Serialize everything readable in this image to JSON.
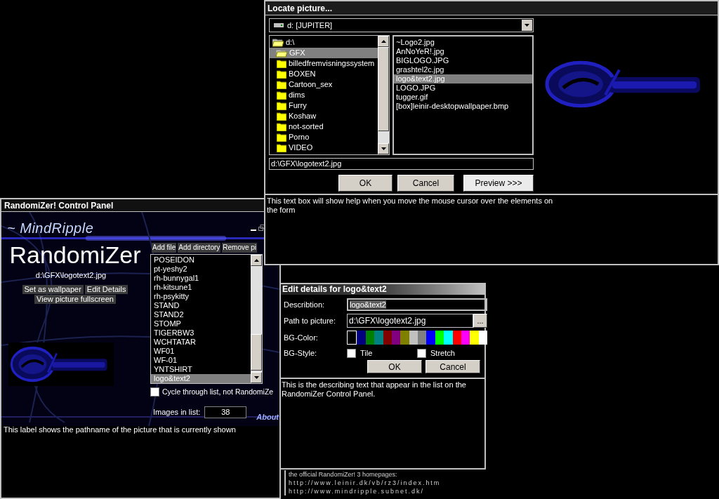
{
  "locate_window": {
    "title": "Locate picture...",
    "drive": {
      "label": "d: [JUPITER]"
    },
    "folders": [
      {
        "name": "d:\\",
        "open": true,
        "selected": false,
        "children": [
          {
            "name": "GFX",
            "open": true,
            "selected": true,
            "children": [
              {
                "name": "billedfremvisningssystem",
                "open": false,
                "selected": false
              },
              {
                "name": "BOXEN",
                "open": false,
                "selected": false
              },
              {
                "name": "Cartoon_sex",
                "open": false,
                "selected": false
              },
              {
                "name": "dims",
                "open": false,
                "selected": false
              },
              {
                "name": "Furry",
                "open": false,
                "selected": false
              },
              {
                "name": "Koshaw",
                "open": false,
                "selected": false
              },
              {
                "name": "not-sorted",
                "open": false,
                "selected": false
              },
              {
                "name": "Porno",
                "open": false,
                "selected": false
              },
              {
                "name": "VIDEO",
                "open": false,
                "selected": false
              }
            ]
          }
        ]
      }
    ],
    "files": [
      {
        "name": "~Logo2.jpg",
        "selected": false
      },
      {
        "name": "AnNoYeR!.jpg",
        "selected": false
      },
      {
        "name": "BIGLOGO.JPG",
        "selected": false
      },
      {
        "name": "grashtel2c.jpg",
        "selected": false
      },
      {
        "name": "logo&text2.jpg",
        "selected": true
      },
      {
        "name": "LOGO.JPG",
        "selected": false
      },
      {
        "name": "tugger.gif",
        "selected": false
      },
      {
        "name": "[box]leinir-desktopwallpaper.bmp",
        "selected": false
      }
    ],
    "path": {
      "value": "d:\\GFX\\logotext2.jpg"
    },
    "buttons": [
      {
        "label": "OK",
        "kind": "plain"
      },
      {
        "label": "Cancel",
        "kind": "plain"
      },
      {
        "label": "Preview >>>",
        "kind": "light"
      }
    ],
    "help_text": "This text box will show help when you move the mouse cursor over the elements on the form"
  },
  "control_panel": {
    "title": "RandomiZer! Control Panel",
    "brand": "~ MindRipple",
    "app_name": "RandomiZer",
    "current_path": "d:\\GFX\\logotext2.jpg",
    "actions": [
      {
        "label": "Set as wallpaper"
      },
      {
        "label": "Edit Details"
      },
      {
        "label": "View picture fullscreen"
      }
    ],
    "list_buttons": [
      {
        "label": "Add file"
      },
      {
        "label": "Add directory"
      },
      {
        "label": "Remove pi"
      }
    ],
    "items": [
      {
        "name": "POSEIDON",
        "selected": false
      },
      {
        "name": "pt-yeshy2",
        "selected": false
      },
      {
        "name": "rh-bunnygal1",
        "selected": false
      },
      {
        "name": "rh-kitsune1",
        "selected": false
      },
      {
        "name": "rh-psykitty",
        "selected": false
      },
      {
        "name": "STAND",
        "selected": false
      },
      {
        "name": "STAND2",
        "selected": false
      },
      {
        "name": "STOMP",
        "selected": false
      },
      {
        "name": "TIGERBW3",
        "selected": false
      },
      {
        "name": "WCHTATAR",
        "selected": false
      },
      {
        "name": "WF01",
        "selected": false
      },
      {
        "name": "WF-01",
        "selected": false
      },
      {
        "name": "YNTSHIRT",
        "selected": false
      },
      {
        "name": "logo&text2",
        "selected": true
      }
    ],
    "cycle": {
      "label": "Cycle through list, not RandomiZe",
      "checked": false
    },
    "count": {
      "label": "Images in list:",
      "value": "38"
    },
    "about": "About",
    "status": "This label shows the pathname of the picture that is currently shown"
  },
  "edit_window": {
    "title": "Edit details for logo&text2",
    "description": {
      "label": "Describtion:",
      "value": "logo&text2"
    },
    "path": {
      "label": "Path to picture:",
      "value": "d:\\GFX\\logotext2.jpg",
      "browse": "..."
    },
    "bg_color": {
      "label": "BG-Color:",
      "swatches": [
        {
          "color": "#000000",
          "selected": true
        },
        {
          "color": "#000080",
          "selected": false
        },
        {
          "color": "#008000",
          "selected": false
        },
        {
          "color": "#008080",
          "selected": false
        },
        {
          "color": "#800000",
          "selected": false
        },
        {
          "color": "#800080",
          "selected": false
        },
        {
          "color": "#808000",
          "selected": false
        },
        {
          "color": "#c0c0c0",
          "selected": false
        },
        {
          "color": "#808080",
          "selected": false
        },
        {
          "color": "#0000ff",
          "selected": false
        },
        {
          "color": "#00ff00",
          "selected": false
        },
        {
          "color": "#00ffff",
          "selected": false
        },
        {
          "color": "#ff0000",
          "selected": false
        },
        {
          "color": "#ff00ff",
          "selected": false
        },
        {
          "color": "#ffff00",
          "selected": false
        },
        {
          "color": "#ffffff",
          "selected": false
        }
      ]
    },
    "bg_style": {
      "label": "BG-Style:",
      "options": [
        {
          "label": "Tile",
          "checked": false
        },
        {
          "label": "Stretch",
          "checked": false
        }
      ]
    },
    "buttons": [
      {
        "label": "OK"
      },
      {
        "label": "Cancel"
      }
    ],
    "help_text": "This is the describing text that appear in the list on the RandomiZer Control Panel."
  },
  "homepages": {
    "heading": "the official RandomiZer! 3 homepages:",
    "links": [
      "http://www.leinir.dk/vb/rz3/index.htm",
      "http://www.mindripple.subnet.dk/"
    ]
  }
}
